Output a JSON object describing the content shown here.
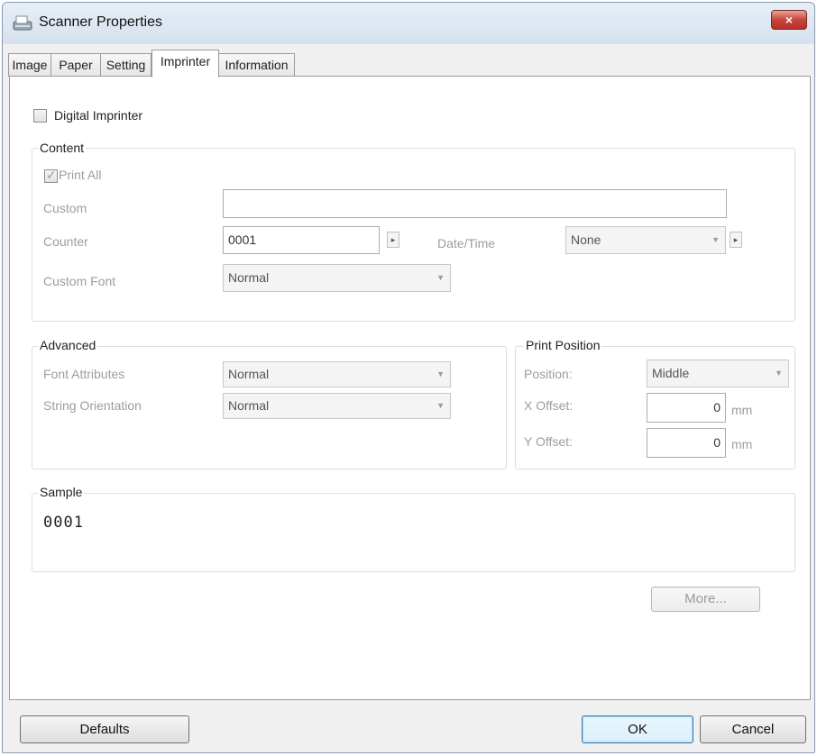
{
  "window": {
    "title": "Scanner Properties",
    "close_label": "×"
  },
  "tabs": [
    {
      "label": "Image"
    },
    {
      "label": "Paper"
    },
    {
      "label": "Setting"
    },
    {
      "label": "Imprinter"
    },
    {
      "label": "Information"
    }
  ],
  "active_tab": "Imprinter",
  "digital_imprinter": {
    "label": "Digital Imprinter",
    "checked": false
  },
  "content": {
    "group_label": "Content",
    "print_all": {
      "label": "Print All",
      "checked": true
    },
    "custom": {
      "label": "Custom",
      "value": ""
    },
    "counter": {
      "label": "Counter",
      "value": "0001",
      "spin": "▸"
    },
    "date_time": {
      "label": "Date/Time",
      "value": "None",
      "spin": "▸"
    },
    "custom_font": {
      "label": "Custom Font",
      "value": "Normal"
    }
  },
  "advanced": {
    "group_label": "Advanced",
    "font_attributes": {
      "label": "Font Attributes",
      "value": "Normal"
    },
    "string_orientation": {
      "label": "String Orientation",
      "value": "Normal"
    }
  },
  "print_position": {
    "group_label": "Print Position",
    "position": {
      "label": "Position:",
      "value": "Middle"
    },
    "x_offset": {
      "label": "X Offset:",
      "value": "0",
      "unit": "mm"
    },
    "y_offset": {
      "label": "Y Offset:",
      "value": "0",
      "unit": "mm"
    }
  },
  "sample": {
    "group_label": "Sample",
    "text": "0001"
  },
  "buttons": {
    "more": "More...",
    "defaults": "Defaults",
    "ok": "OK",
    "cancel": "Cancel"
  },
  "combo_arrow": "▼"
}
